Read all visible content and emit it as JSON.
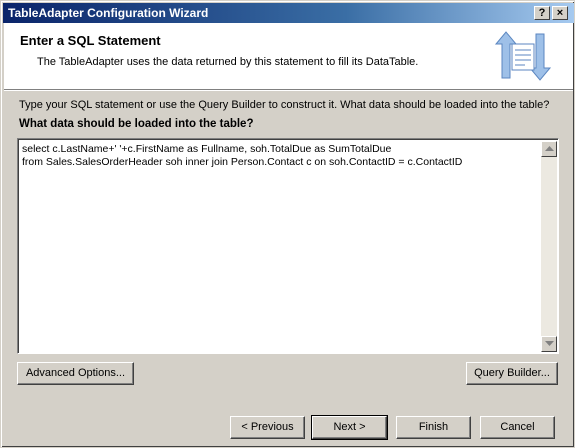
{
  "window": {
    "title": "TableAdapter Configuration Wizard",
    "help_button": "?",
    "close_button": "×"
  },
  "header": {
    "title": "Enter a SQL Statement",
    "description": "The TableAdapter uses the data returned by this statement to fill its DataTable."
  },
  "body": {
    "instructions": "Type your SQL statement or use the Query Builder to construct it. What data should be loaded into the table?",
    "question": "What data should be loaded into the table?",
    "sql": "select c.LastName+' '+c.FirstName as Fullname, soh.TotalDue as SumTotalDue\nfrom Sales.SalesOrderHeader soh inner join Person.Contact c on soh.ContactID = c.ContactID"
  },
  "buttons": {
    "advanced_options": "Advanced Options...",
    "query_builder": "Query Builder...",
    "previous": "< Previous",
    "next": "Next >",
    "finish": "Finish",
    "cancel": "Cancel"
  },
  "colors": {
    "titlebar_start": "#0a246a",
    "titlebar_end": "#a6caf0",
    "dialog_face": "#d4d0c8"
  }
}
